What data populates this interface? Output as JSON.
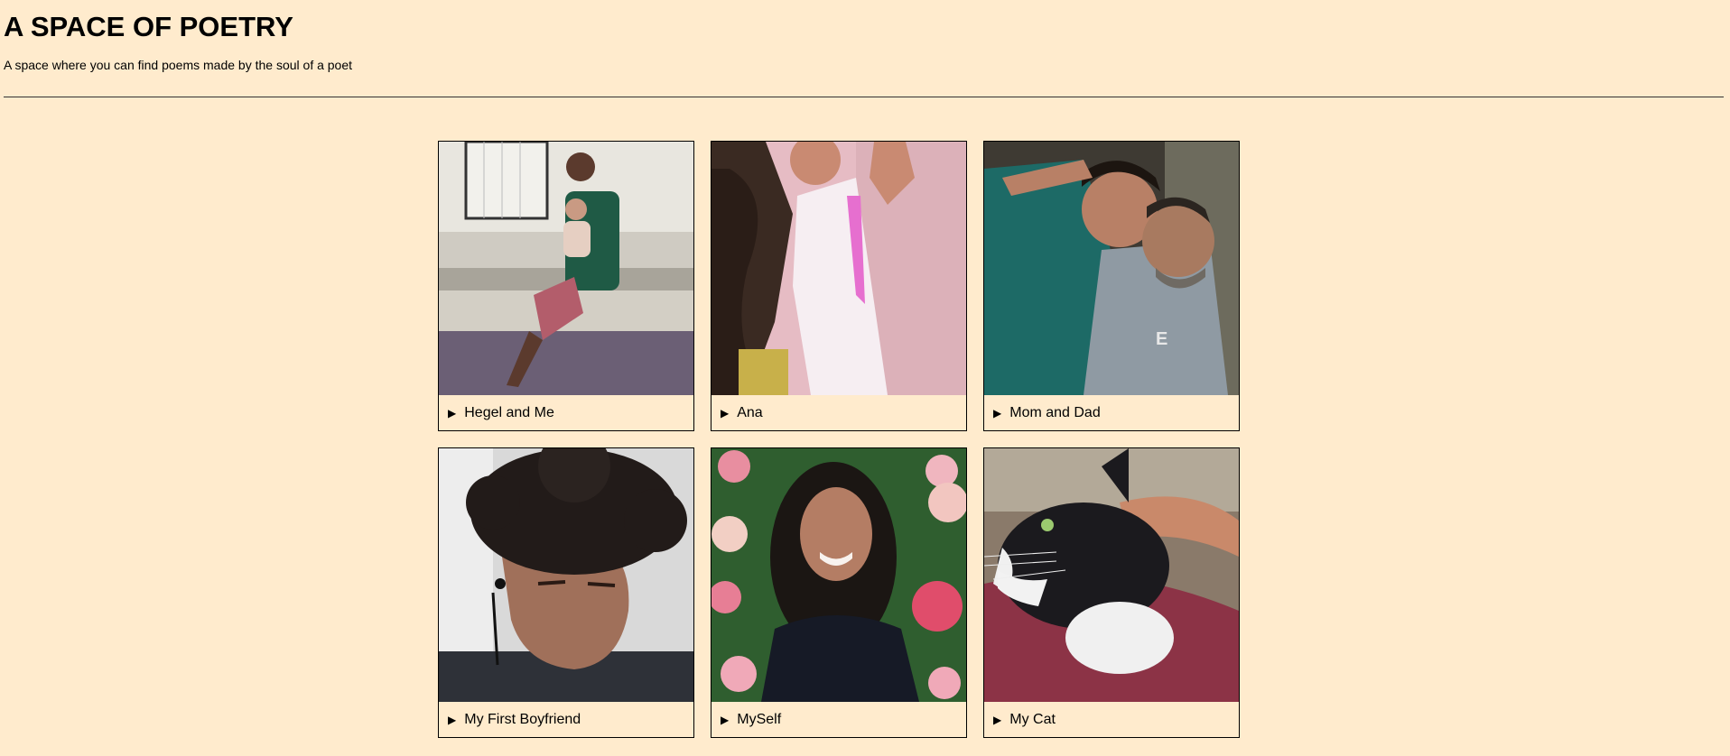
{
  "header": {
    "title": "A SPACE OF POETRY",
    "subtitle": "A space where you can find poems made by the soul of a poet"
  },
  "gallery": {
    "cards": [
      {
        "caption": "Hegel and Me",
        "photo": "two-children-on-steps"
      },
      {
        "caption": "Ana",
        "photo": "girl-with-curly-hair"
      },
      {
        "caption": "Mom and Dad",
        "photo": "couple-smiling"
      },
      {
        "caption": "My First Boyfriend",
        "photo": "young-man-curly-hair"
      },
      {
        "caption": "MySelf",
        "photo": "woman-among-roses"
      },
      {
        "caption": "My Cat",
        "photo": "black-and-white-cat"
      }
    ]
  },
  "colors": {
    "background": "#ffebcd",
    "border": "#000000"
  }
}
